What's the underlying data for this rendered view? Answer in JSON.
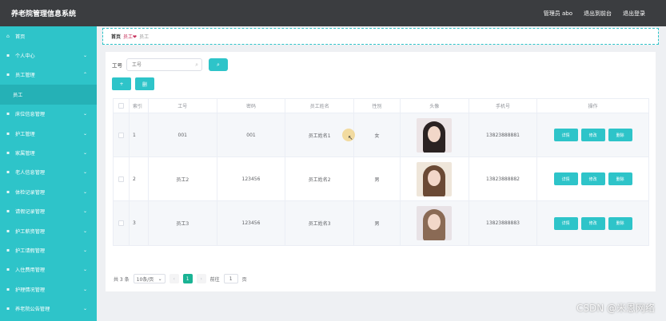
{
  "app": {
    "title": "养老院管理信息系统"
  },
  "topbar": {
    "admin": "管理员 abo",
    "back_to_front": "退出到前台",
    "logout": "退出登录"
  },
  "sidebar": {
    "items": [
      {
        "label": "首页",
        "expandable": false
      },
      {
        "label": "个人中心",
        "expandable": true
      },
      {
        "label": "员工管理",
        "expandable": true
      },
      {
        "label": "员工",
        "expandable": false,
        "sub": true
      },
      {
        "label": "床位信息管理",
        "expandable": true
      },
      {
        "label": "护工管理",
        "expandable": true
      },
      {
        "label": "家属管理",
        "expandable": true
      },
      {
        "label": "老人信息管理",
        "expandable": true
      },
      {
        "label": "体检记录管理",
        "expandable": true
      },
      {
        "label": "请假记录管理",
        "expandable": true
      },
      {
        "label": "护工薪资管理",
        "expandable": true
      },
      {
        "label": "护工请假管理",
        "expandable": true
      },
      {
        "label": "入住费用管理",
        "expandable": true
      },
      {
        "label": "护理情况管理",
        "expandable": true
      },
      {
        "label": "养老院公告管理",
        "expandable": true
      }
    ]
  },
  "breadcrumb": {
    "home": "首页",
    "section": "员工",
    "current": "员工"
  },
  "search": {
    "label": "工号",
    "placeholder": "工号"
  },
  "actions": {
    "add": "+",
    "delete": "删"
  },
  "table": {
    "headers": [
      "",
      "索引",
      "工号",
      "密码",
      "员工姓名",
      "性别",
      "头像",
      "手机号",
      "操作"
    ],
    "rows": [
      {
        "index": "1",
        "no": "001",
        "password": "001",
        "name": "员工姓名1",
        "sex": "女",
        "phone": "13823888881"
      },
      {
        "index": "2",
        "no": "员工2",
        "password": "123456",
        "name": "员工姓名2",
        "sex": "男",
        "phone": "13823888882"
      },
      {
        "index": "3",
        "no": "员工3",
        "password": "123456",
        "name": "员工姓名3",
        "sex": "男",
        "phone": "13823888883"
      }
    ],
    "ops": {
      "detail": "详情",
      "edit": "修改",
      "delete": "删除"
    }
  },
  "pager": {
    "total": "共 3 条",
    "size": "10条/页",
    "page": "1",
    "goto": "前往",
    "goto_page": "1",
    "page_suffix": "页"
  },
  "watermark": "CSDN @米恩网络",
  "colors": {
    "accent": "#2ec4c9",
    "topbar": "#3b3d40",
    "active_page": "#1ab394"
  }
}
